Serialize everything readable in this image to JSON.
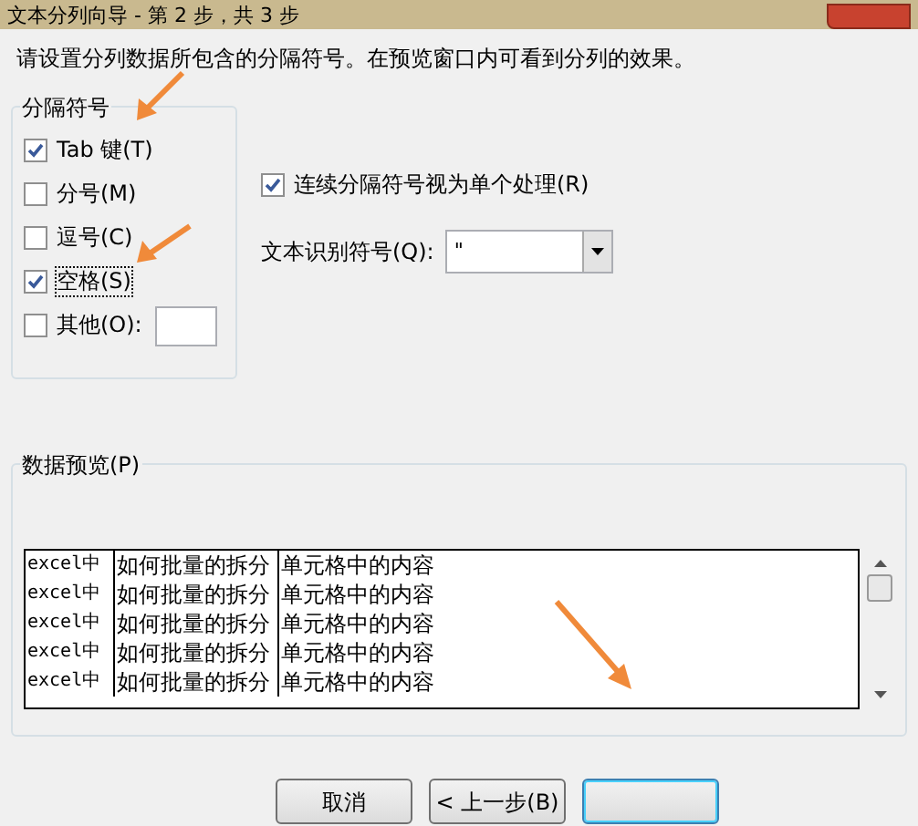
{
  "window": {
    "title": "文本分列向导 - 第 2 步，共 3 步"
  },
  "instruction": "请设置分列数据所包含的分隔符号。在预览窗口内可看到分列的效果。",
  "delimiters": {
    "title": "分隔符号",
    "items": [
      {
        "label": "Tab 键(T)",
        "checked": true,
        "focused": false
      },
      {
        "label": "分号(M)",
        "checked": false,
        "focused": false
      },
      {
        "label": "逗号(C)",
        "checked": false,
        "focused": false
      },
      {
        "label": "空格(S)",
        "checked": true,
        "focused": true
      },
      {
        "label": "其他(O):",
        "checked": false,
        "focused": false,
        "has_field": true
      }
    ]
  },
  "consecutive": {
    "label": "连续分隔符号视为单个处理(R)",
    "checked": true
  },
  "qualifier": {
    "label": "文本识别符号(Q):",
    "value": "\""
  },
  "preview": {
    "title": "数据预览(P)",
    "rows": [
      [
        "excel中",
        "如何批量的拆分",
        "单元格中的内容"
      ],
      [
        "excel中",
        "如何批量的拆分",
        "单元格中的内容"
      ],
      [
        "excel中",
        "如何批量的拆分",
        "单元格中的内容"
      ],
      [
        "excel中",
        "如何批量的拆分",
        "单元格中的内容"
      ],
      [
        "excel中",
        "如何批量的拆分",
        "单元格中的内容"
      ]
    ]
  },
  "buttons": [
    {
      "label": "取消",
      "kind": "normal"
    },
    {
      "label": "< 上一步(B)",
      "kind": "normal"
    },
    {
      "kind": "default"
    }
  ]
}
